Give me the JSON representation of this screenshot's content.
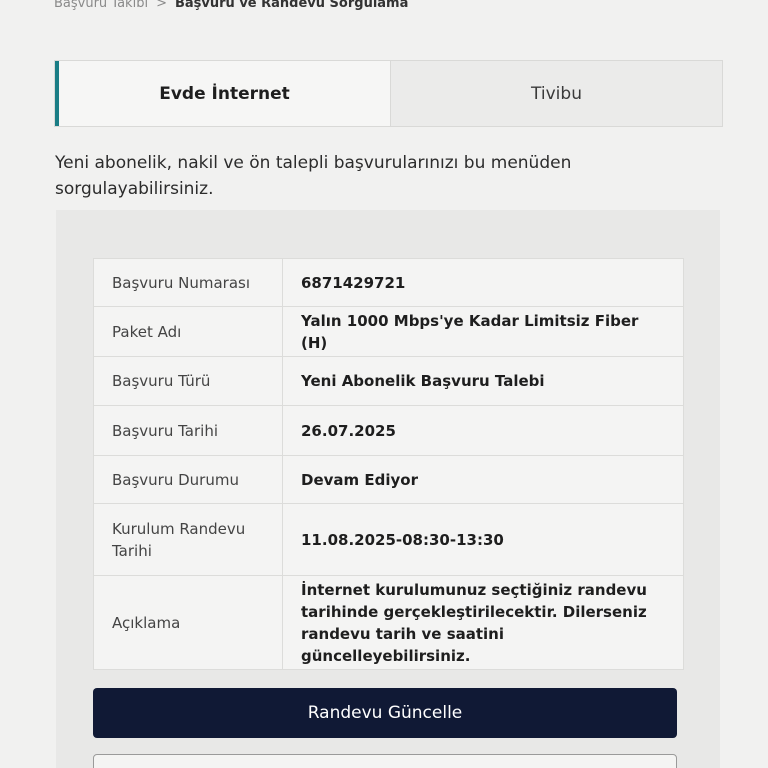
{
  "breadcrumb": {
    "previous": "Başvuru Takibi",
    "separator": ">",
    "current": "Başvuru ve Randevu Sorgulama"
  },
  "tabs": [
    {
      "label": "Evde İnternet",
      "active": true
    },
    {
      "label": "Tivibu",
      "active": false
    }
  ],
  "intro_text": "Yeni abonelik, nakil ve ön talepli başvurularınızı bu menüden sorgulayabilirsiniz.",
  "details": [
    {
      "label": "Başvuru Numarası",
      "value": "6871429721"
    },
    {
      "label": "Paket Adı",
      "value": "Yalın 1000 Mbps'ye Kadar Limitsiz Fiber (H)"
    },
    {
      "label": "Başvuru Türü",
      "value": "Yeni Abonelik Başvuru Talebi"
    },
    {
      "label": "Başvuru Tarihi",
      "value": "26.07.2025"
    },
    {
      "label": "Başvuru Durumu",
      "value": "Devam Ediyor"
    },
    {
      "label": "Kurulum Randevu Tarihi",
      "value": "11.08.2025-08:30-13:30"
    },
    {
      "label": "Açıklama",
      "value": "İnternet kurulumunuz seçtiğiniz randevu tarihinde gerçekleştirilecektir. Dilerseniz randevu tarih ve saatini güncelleyebilirsiniz."
    }
  ],
  "primary_button": "Randevu Güncelle",
  "colors": {
    "accent": "#1a7d85",
    "primary_button_bg": "#101935"
  }
}
